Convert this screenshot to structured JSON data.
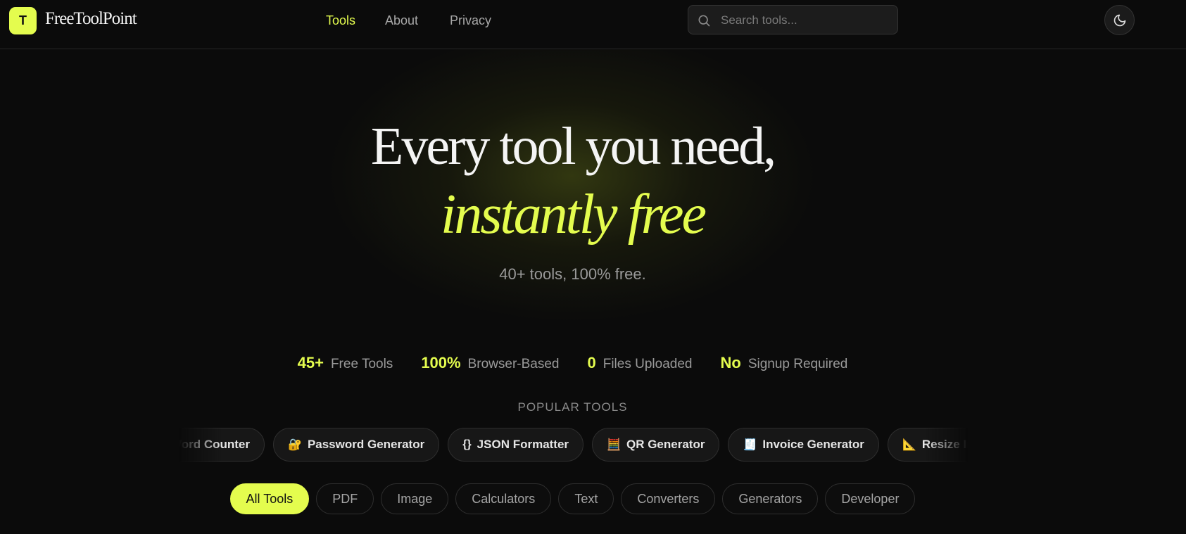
{
  "header": {
    "logo_letter": "T",
    "logo_text": "FreeToolPoint",
    "nav": [
      {
        "label": "Tools",
        "active": true
      },
      {
        "label": "About",
        "active": false
      },
      {
        "label": "Privacy",
        "active": false
      }
    ],
    "search_placeholder": "Search tools..."
  },
  "hero": {
    "line1": "Every tool you need,",
    "line2": "instantly free",
    "subtitle": "40+ tools, 100% free."
  },
  "stats": [
    {
      "value": "45+",
      "label": "Free Tools"
    },
    {
      "value": "100%",
      "label": "Browser-Based"
    },
    {
      "value": "0",
      "label": "Files Uploaded"
    },
    {
      "value": "No",
      "label": "Signup Required"
    }
  ],
  "popular": {
    "label": "POPULAR TOOLS",
    "items": [
      {
        "icon": "",
        "label": "Word Counter"
      },
      {
        "icon": "🔐",
        "label": "Password Generator"
      },
      {
        "icon": "{}",
        "label": "JSON Formatter"
      },
      {
        "icon": "🧮",
        "label": "QR Generator"
      },
      {
        "icon": "🧾",
        "label": "Invoice Generator"
      },
      {
        "icon": "📐",
        "label": "Resize Image"
      }
    ]
  },
  "categories": [
    {
      "label": "All Tools",
      "active": true
    },
    {
      "label": "PDF",
      "active": false
    },
    {
      "label": "Image",
      "active": false
    },
    {
      "label": "Calculators",
      "active": false
    },
    {
      "label": "Text",
      "active": false
    },
    {
      "label": "Converters",
      "active": false
    },
    {
      "label": "Generators",
      "active": false
    },
    {
      "label": "Developer",
      "active": false
    }
  ],
  "colors": {
    "accent": "#e4fc4e",
    "background": "#0b0b0b"
  }
}
